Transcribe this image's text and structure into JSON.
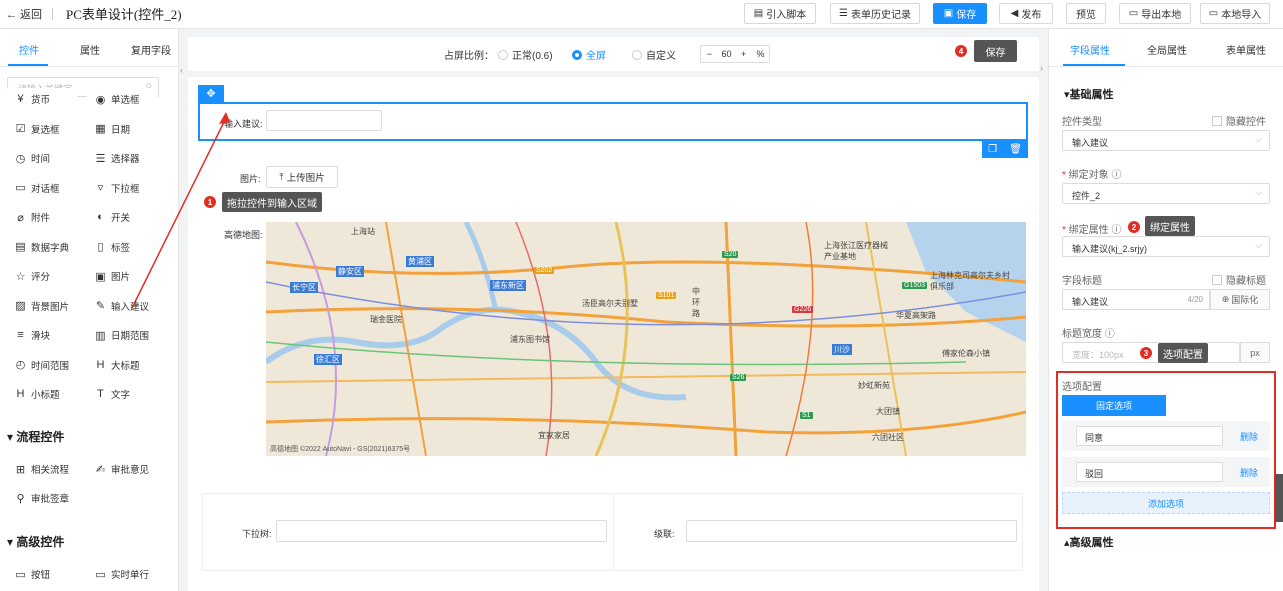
{
  "topbar": {
    "back": "← 返回",
    "title": "PC表单设计(控件_2)",
    "buttons": {
      "import_script": "引入脚本",
      "history": "表单历史记录",
      "save": "保存",
      "publish": "发布",
      "preview": "预览",
      "export_local": "导出本地",
      "import_local": "本地导入"
    }
  },
  "left": {
    "tabs": [
      "控件",
      "属性",
      "复用字段"
    ],
    "search_placeholder": "请输入关键字",
    "basic": [
      {
        "icon": "currency-icon",
        "glyph": "¥",
        "label": "货币"
      },
      {
        "icon": "radio-icon",
        "glyph": "◉",
        "label": "单选框"
      },
      {
        "icon": "checkbox-icon",
        "glyph": "☑",
        "label": "复选框"
      },
      {
        "icon": "calendar-icon",
        "glyph": "▦",
        "label": "日期"
      },
      {
        "icon": "clock-icon",
        "glyph": "◷",
        "label": "时间"
      },
      {
        "icon": "selector-icon",
        "glyph": "☰",
        "label": "选择器"
      },
      {
        "icon": "dialog-icon",
        "glyph": "▭",
        "label": "对话框"
      },
      {
        "icon": "dropdown-icon",
        "glyph": "▿",
        "label": "下拉框"
      },
      {
        "icon": "attachment-icon",
        "glyph": "⌀",
        "label": "附件"
      },
      {
        "icon": "switch-icon",
        "glyph": "◐",
        "label": "开关"
      },
      {
        "icon": "dictionary-icon",
        "glyph": "▤",
        "label": "数据字典"
      },
      {
        "icon": "tag-icon",
        "glyph": "▯",
        "label": "标签"
      },
      {
        "icon": "star-icon",
        "glyph": "☆",
        "label": "评分"
      },
      {
        "icon": "image-icon",
        "glyph": "▣",
        "label": "图片"
      },
      {
        "icon": "bg-image-icon",
        "glyph": "▨",
        "label": "背景图片"
      },
      {
        "icon": "pen-icon",
        "glyph": "✎",
        "label": "输入建议"
      },
      {
        "icon": "slider-icon",
        "glyph": "≡",
        "label": "滑块"
      },
      {
        "icon": "date-range-icon",
        "glyph": "▥",
        "label": "日期范围"
      },
      {
        "icon": "time-range-icon",
        "glyph": "◴",
        "label": "时间范围"
      },
      {
        "icon": "heading-icon",
        "glyph": "H",
        "label": "大标题"
      },
      {
        "icon": "subheading-icon",
        "glyph": "H",
        "label": "小标题"
      },
      {
        "icon": "text-icon",
        "glyph": "T",
        "label": "文字"
      }
    ],
    "flow_title": "流程控件",
    "flow": [
      {
        "icon": "flow-icon",
        "glyph": "⊞",
        "label": "相关流程"
      },
      {
        "icon": "opinion-icon",
        "glyph": "✍",
        "label": "审批意见"
      },
      {
        "icon": "stamp-icon",
        "glyph": "⚲",
        "label": "审批签章"
      }
    ],
    "adv_title": "高级控件",
    "adv": [
      {
        "icon": "button-icon",
        "glyph": "▭",
        "label": "按钮"
      },
      {
        "icon": "realtime-icon",
        "glyph": "▭",
        "label": "实时单行"
      }
    ]
  },
  "canvas": {
    "ratio_label": "占屏比例：",
    "options": [
      "正常(0.6)",
      "全屏",
      "自定义"
    ],
    "zoom": "60",
    "zoom_unit": "%",
    "save_tip": "保存",
    "input_suggest_label": "输入建议:",
    "image_label": "图片:",
    "upload": "上传图片",
    "map_label": "高德地图:",
    "tip1": "拖拉控件到输入区域",
    "dropdown_label": "下拉树:",
    "cascade_label": "级联:",
    "map_places": [
      "上海站",
      "黄浦区",
      "静安区",
      "长宁区",
      "瑞金医院",
      "浦东新区",
      "汤臣高尔夫别墅",
      "上海张江医疗器械产业基地",
      "上海林克司高尔夫乡村俱乐部",
      "华夏高架路",
      "浦东图书馆",
      "徐汇区",
      "中环路",
      "妙虹新苑",
      "傅家伦森小镇",
      "宜家家居",
      "六团社区",
      "大团镇",
      "川沙"
    ],
    "road_tags": [
      "S202",
      "S20",
      "S101",
      "G226",
      "G1503",
      "S1",
      "S26"
    ],
    "map_credit": "高德地图 ©2022 AutoNavi - GS(2021)6375号"
  },
  "right": {
    "tabs": [
      "字段属性",
      "全局属性",
      "表单属性"
    ],
    "basic_title": "▾基础属性",
    "ctrl_type_label": "控件类型",
    "hide_ctrl": "隐藏控件",
    "ctrl_type_value": "输入建议",
    "bind_obj_label": "绑定对象",
    "bind_obj_value": "控件_2",
    "bind_attr_label": "绑定属性",
    "bind_attr_value": "输入建议(kj_2.srjy)",
    "tip2": "绑定属性",
    "field_title_label": "字段标题",
    "hide_title": "隐藏标题",
    "field_title_value": "输入建议",
    "field_count": "4/20",
    "i18n": "国际化",
    "title_width_label": "标题宽度",
    "title_width_placeholder": "宽度：100px",
    "px": "px",
    "tip3": "选项配置",
    "options_label": "选项配置",
    "fixed_options": "固定选项",
    "options": [
      "同意",
      "驳回"
    ],
    "delete": "删除",
    "add_option": "添加选项",
    "adv_title": "▴高级属性"
  },
  "badges": [
    "1",
    "2",
    "3",
    "4"
  ],
  "colors": {
    "accent": "#1890ff",
    "danger": "#e02e24",
    "tip_bg": "#555555"
  }
}
